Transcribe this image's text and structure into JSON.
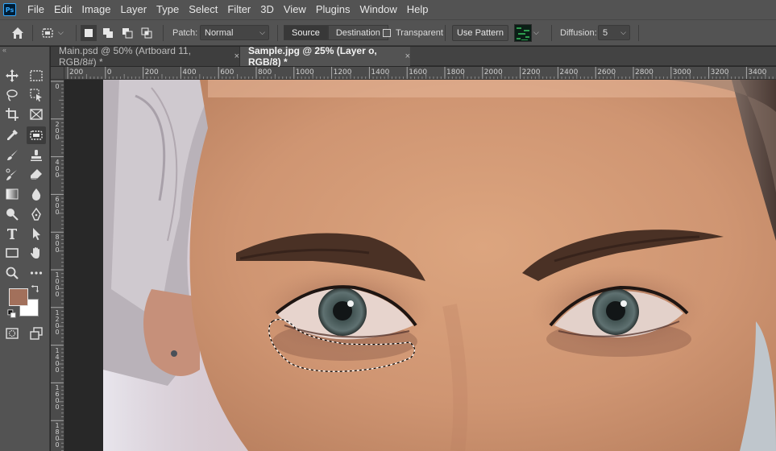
{
  "app": {
    "logo_text": "Ps"
  },
  "menu": [
    "File",
    "Edit",
    "Image",
    "Layer",
    "Type",
    "Select",
    "Filter",
    "3D",
    "View",
    "Plugins",
    "Window",
    "Help"
  ],
  "options_bar": {
    "patch_label": "Patch:",
    "patch_value": "Normal",
    "source_label": "Source",
    "destination_label": "Destination",
    "transparent_label": "Transparent",
    "use_pattern_label": "Use Pattern",
    "diffusion_label": "Diffusion:",
    "diffusion_value": "5"
  },
  "tabs": [
    {
      "label": "Main.psd @ 50% (Artboard 11, RGB/8#) *",
      "close": "×",
      "active": false
    },
    {
      "label": "Sample.jpg @ 25% (Layer o, RGB/8) *",
      "close": "×",
      "active": true
    }
  ],
  "ruler": {
    "h_ticks": [
      "200",
      "0",
      "200",
      "400",
      "600",
      "800",
      "1000",
      "1200",
      "1400",
      "1600",
      "1800",
      "2000",
      "2200",
      "2400",
      "2600",
      "2800",
      "3000",
      "3200",
      "3400"
    ],
    "v_ticks": [
      "0",
      "2\n0\n0",
      "4\n0\n0",
      "6\n0\n0",
      "8\n0\n0",
      "1\n0\n0\n0",
      "1\n2\n0\n0",
      "1\n4\n0\n0",
      "1\n6\n0\n0",
      "1\n8\n0\n0"
    ]
  },
  "colors": {
    "foreground": "#a2705b",
    "background": "#ffffff",
    "ui_panel": "#535353",
    "pasteboard": "#282828"
  },
  "toolbar": {
    "tools": [
      "move-tool",
      "marquee-tool",
      "lasso-tool",
      "object-select-tool",
      "crop-tool",
      "frame-tool",
      "eyedropper-tool",
      "patch-tool",
      "brush-tool",
      "clone-stamp-tool",
      "history-brush-tool",
      "eraser-tool",
      "gradient-tool",
      "blur-tool",
      "dodge-tool",
      "pen-tool",
      "type-tool",
      "path-select-tool",
      "rectangle-tool",
      "hand-tool",
      "zoom-tool",
      "more-tools"
    ]
  }
}
